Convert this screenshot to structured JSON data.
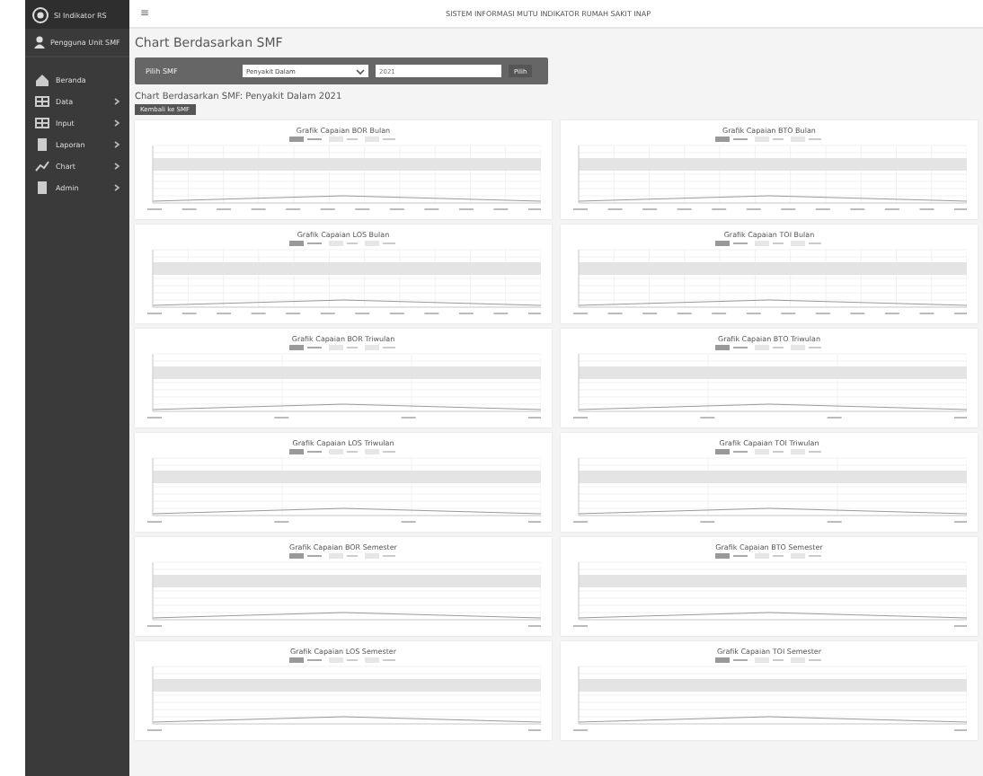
{
  "sidebar": {
    "brand": "SI Indikator RS",
    "user": "Pengguna Unit SMF",
    "items": [
      {
        "label": "Beranda",
        "kind": "home",
        "submenu": false
      },
      {
        "label": "Data",
        "kind": "table",
        "submenu": true
      },
      {
        "label": "Input",
        "kind": "table",
        "submenu": true
      },
      {
        "label": "Laporan",
        "kind": "file",
        "submenu": true
      },
      {
        "label": "Chart",
        "kind": "chart",
        "submenu": true
      },
      {
        "label": "Admin",
        "kind": "file",
        "submenu": true
      }
    ]
  },
  "topbar": {
    "menu_glyph": "≡",
    "title": "SISTEM INFORMASI MUTU INDIKATOR RUMAH SAKIT INAP"
  },
  "page_title": "Chart Berdasarkan SMF",
  "filter": {
    "label": "Pilih SMF",
    "select_value": "Penyakit Dalam",
    "input_value": "2021",
    "button": "Pilih"
  },
  "subtitle": "Chart Berdasarkan SMF: Penyakit Dalam 2021",
  "back_button": "Kembali ke SMF",
  "charts": [
    {
      "title": "Grafik Capaian BOR Bulan"
    },
    {
      "title": "Grafik Capaian BTO Bulan"
    },
    {
      "title": "Grafik Capaian LOS Bulan"
    },
    {
      "title": "Grafik Capaian TOI Bulan"
    },
    {
      "title": "Grafik Capaian BOR Triwulan"
    },
    {
      "title": "Grafik Capaian BTO Triwulan"
    },
    {
      "title": "Grafik Capaian LOS Triwulan"
    },
    {
      "title": "Grafik Capaian TOI Triwulan"
    },
    {
      "title": "Grafik Capaian BOR Semester"
    },
    {
      "title": "Grafik Capaian BTO Semester"
    },
    {
      "title": "Grafik Capaian LOS Semester"
    },
    {
      "title": "Grafik Capaian TOI Semester"
    }
  ]
}
